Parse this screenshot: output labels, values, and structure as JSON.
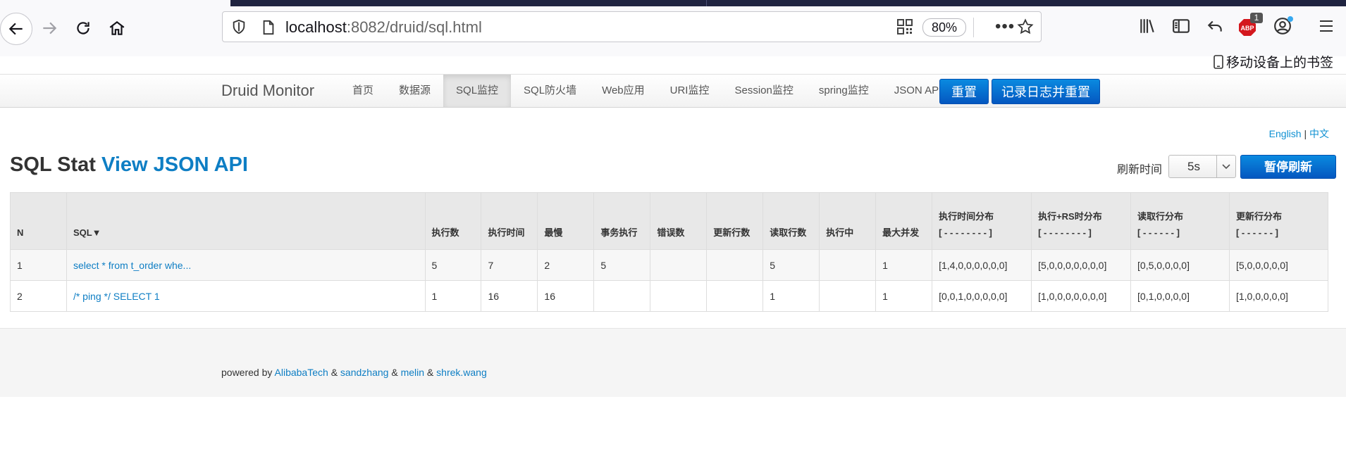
{
  "browser": {
    "url_host": "localhost",
    "url_path": ":8082/druid/sql.html",
    "zoom": "80%",
    "more": "•••",
    "abp_label": "ABP",
    "abp_badge": "1",
    "bookmarks_label": "移动设备上的书签"
  },
  "navbar": {
    "brand": "Druid Monitor",
    "items": [
      "首页",
      "数据源",
      "SQL监控",
      "SQL防火墙",
      "Web应用",
      "URI监控",
      "Session监控",
      "spring监控",
      "JSON API"
    ],
    "active_index": 2,
    "reset_label": "重置",
    "log_reset_label": "记录日志并重置"
  },
  "lang": {
    "english": "English",
    "sep": "|",
    "chinese": "中文"
  },
  "page": {
    "title": "SQL Stat",
    "title_link": "View JSON API",
    "refresh_label": "刷新时间",
    "refresh_value": "5s",
    "pause_label": "暂停刷新"
  },
  "table": {
    "headers": [
      "N",
      "SQL▼",
      "执行数",
      "执行时间",
      "最慢",
      "事务执行",
      "错误数",
      "更新行数",
      "读取行数",
      "执行中",
      "最大并发"
    ],
    "dist_headers": [
      {
        "title": "执行时间分布",
        "sub": "[ - - - - - - - - ]"
      },
      {
        "title": "执行+RS时分布",
        "sub": "[ - - - - - - - - ]"
      },
      {
        "title": "读取行分布",
        "sub": "[ - - - - - - ]"
      },
      {
        "title": "更新行分布",
        "sub": "[ - - - - - - ]"
      }
    ],
    "rows": [
      {
        "n": "1",
        "sql": "select * from t_order whe...",
        "exec": "5",
        "time": "7",
        "slowest": "2",
        "tx": "5",
        "err": "",
        "upd": "",
        "read": "5",
        "running": "",
        "concurrent": "1",
        "d1": "[1,4,0,0,0,0,0,0]",
        "d2": "[5,0,0,0,0,0,0,0]",
        "d3": "[0,5,0,0,0,0]",
        "d4": "[5,0,0,0,0,0]"
      },
      {
        "n": "2",
        "sql": "/* ping */ SELECT 1",
        "exec": "1",
        "time": "16",
        "slowest": "16",
        "tx": "",
        "err": "",
        "upd": "",
        "read": "1",
        "running": "",
        "concurrent": "1",
        "d1": "[0,0,1,0,0,0,0,0]",
        "d2": "[1,0,0,0,0,0,0,0]",
        "d3": "[0,1,0,0,0,0]",
        "d4": "[1,0,0,0,0,0]"
      }
    ]
  },
  "footer": {
    "powered_by": "powered by",
    "amp": "&",
    "links": [
      "AlibabaTech",
      "sandzhang",
      "melin",
      "shrek.wang"
    ]
  }
}
